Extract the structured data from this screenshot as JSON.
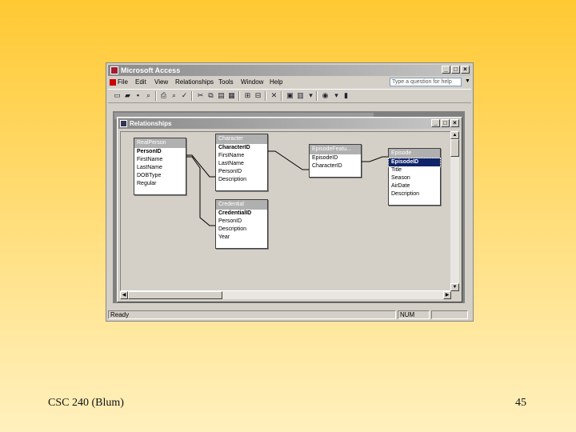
{
  "slide": {
    "footer_left": "CSC 240 (Blum)",
    "footer_right": "45"
  },
  "app": {
    "title": "Microsoft Access",
    "menu": [
      "File",
      "Edit",
      "View",
      "Relationships",
      "Tools",
      "Window",
      "Help"
    ],
    "ask_placeholder": "Type a question for help",
    "status_left": "Ready",
    "status_num": "NUM",
    "accent_color": "#10246a"
  },
  "child_window": {
    "title": "Relationships"
  },
  "tables": [
    {
      "title": "RealPerson",
      "fields": [
        "PersonID",
        "FirstName",
        "LastName",
        "DOBType",
        "Regular"
      ],
      "key": 0
    },
    {
      "title": "Character",
      "fields": [
        "CharacterID",
        "FirstName",
        "LastName",
        "PersonID",
        "Description"
      ],
      "key": 0
    },
    {
      "title": "Credential",
      "fields": [
        "CredentialID",
        "PersonID",
        "Description",
        "Year"
      ],
      "key": 0
    },
    {
      "title": "EpisodeFeatu...",
      "fields": [
        "EpisodeID",
        "CharacterID"
      ],
      "key": -1
    },
    {
      "title": "Episode",
      "fields": [
        "EpisodeID",
        "Title",
        "Season",
        "AirDate",
        "Description"
      ],
      "key": 0,
      "selected": 0
    }
  ]
}
